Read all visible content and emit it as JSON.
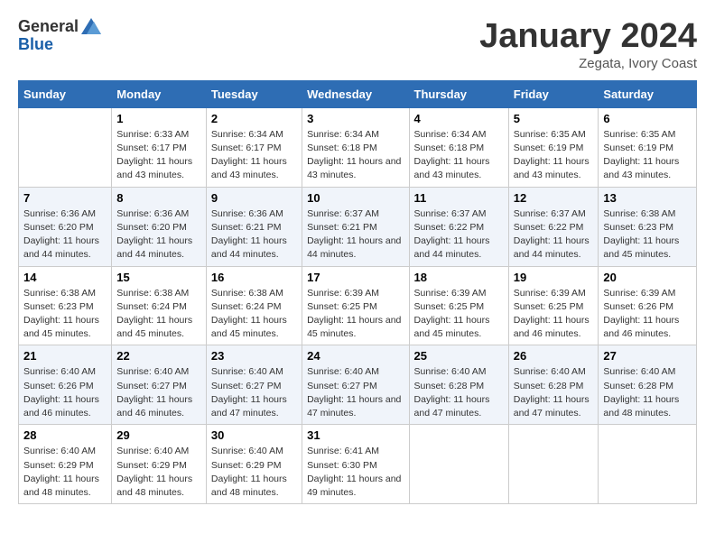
{
  "header": {
    "logo_general": "General",
    "logo_blue": "Blue",
    "month": "January 2024",
    "location": "Zegata, Ivory Coast"
  },
  "weekdays": [
    "Sunday",
    "Monday",
    "Tuesday",
    "Wednesday",
    "Thursday",
    "Friday",
    "Saturday"
  ],
  "weeks": [
    [
      {
        "day": "",
        "sunrise": "",
        "sunset": "",
        "daylight": ""
      },
      {
        "day": "1",
        "sunrise": "Sunrise: 6:33 AM",
        "sunset": "Sunset: 6:17 PM",
        "daylight": "Daylight: 11 hours and 43 minutes."
      },
      {
        "day": "2",
        "sunrise": "Sunrise: 6:34 AM",
        "sunset": "Sunset: 6:17 PM",
        "daylight": "Daylight: 11 hours and 43 minutes."
      },
      {
        "day": "3",
        "sunrise": "Sunrise: 6:34 AM",
        "sunset": "Sunset: 6:18 PM",
        "daylight": "Daylight: 11 hours and 43 minutes."
      },
      {
        "day": "4",
        "sunrise": "Sunrise: 6:34 AM",
        "sunset": "Sunset: 6:18 PM",
        "daylight": "Daylight: 11 hours and 43 minutes."
      },
      {
        "day": "5",
        "sunrise": "Sunrise: 6:35 AM",
        "sunset": "Sunset: 6:19 PM",
        "daylight": "Daylight: 11 hours and 43 minutes."
      },
      {
        "day": "6",
        "sunrise": "Sunrise: 6:35 AM",
        "sunset": "Sunset: 6:19 PM",
        "daylight": "Daylight: 11 hours and 43 minutes."
      }
    ],
    [
      {
        "day": "7",
        "sunrise": "Sunrise: 6:36 AM",
        "sunset": "Sunset: 6:20 PM",
        "daylight": "Daylight: 11 hours and 44 minutes."
      },
      {
        "day": "8",
        "sunrise": "Sunrise: 6:36 AM",
        "sunset": "Sunset: 6:20 PM",
        "daylight": "Daylight: 11 hours and 44 minutes."
      },
      {
        "day": "9",
        "sunrise": "Sunrise: 6:36 AM",
        "sunset": "Sunset: 6:21 PM",
        "daylight": "Daylight: 11 hours and 44 minutes."
      },
      {
        "day": "10",
        "sunrise": "Sunrise: 6:37 AM",
        "sunset": "Sunset: 6:21 PM",
        "daylight": "Daylight: 11 hours and 44 minutes."
      },
      {
        "day": "11",
        "sunrise": "Sunrise: 6:37 AM",
        "sunset": "Sunset: 6:22 PM",
        "daylight": "Daylight: 11 hours and 44 minutes."
      },
      {
        "day": "12",
        "sunrise": "Sunrise: 6:37 AM",
        "sunset": "Sunset: 6:22 PM",
        "daylight": "Daylight: 11 hours and 44 minutes."
      },
      {
        "day": "13",
        "sunrise": "Sunrise: 6:38 AM",
        "sunset": "Sunset: 6:23 PM",
        "daylight": "Daylight: 11 hours and 45 minutes."
      }
    ],
    [
      {
        "day": "14",
        "sunrise": "Sunrise: 6:38 AM",
        "sunset": "Sunset: 6:23 PM",
        "daylight": "Daylight: 11 hours and 45 minutes."
      },
      {
        "day": "15",
        "sunrise": "Sunrise: 6:38 AM",
        "sunset": "Sunset: 6:24 PM",
        "daylight": "Daylight: 11 hours and 45 minutes."
      },
      {
        "day": "16",
        "sunrise": "Sunrise: 6:38 AM",
        "sunset": "Sunset: 6:24 PM",
        "daylight": "Daylight: 11 hours and 45 minutes."
      },
      {
        "day": "17",
        "sunrise": "Sunrise: 6:39 AM",
        "sunset": "Sunset: 6:25 PM",
        "daylight": "Daylight: 11 hours and 45 minutes."
      },
      {
        "day": "18",
        "sunrise": "Sunrise: 6:39 AM",
        "sunset": "Sunset: 6:25 PM",
        "daylight": "Daylight: 11 hours and 45 minutes."
      },
      {
        "day": "19",
        "sunrise": "Sunrise: 6:39 AM",
        "sunset": "Sunset: 6:25 PM",
        "daylight": "Daylight: 11 hours and 46 minutes."
      },
      {
        "day": "20",
        "sunrise": "Sunrise: 6:39 AM",
        "sunset": "Sunset: 6:26 PM",
        "daylight": "Daylight: 11 hours and 46 minutes."
      }
    ],
    [
      {
        "day": "21",
        "sunrise": "Sunrise: 6:40 AM",
        "sunset": "Sunset: 6:26 PM",
        "daylight": "Daylight: 11 hours and 46 minutes."
      },
      {
        "day": "22",
        "sunrise": "Sunrise: 6:40 AM",
        "sunset": "Sunset: 6:27 PM",
        "daylight": "Daylight: 11 hours and 46 minutes."
      },
      {
        "day": "23",
        "sunrise": "Sunrise: 6:40 AM",
        "sunset": "Sunset: 6:27 PM",
        "daylight": "Daylight: 11 hours and 47 minutes."
      },
      {
        "day": "24",
        "sunrise": "Sunrise: 6:40 AM",
        "sunset": "Sunset: 6:27 PM",
        "daylight": "Daylight: 11 hours and 47 minutes."
      },
      {
        "day": "25",
        "sunrise": "Sunrise: 6:40 AM",
        "sunset": "Sunset: 6:28 PM",
        "daylight": "Daylight: 11 hours and 47 minutes."
      },
      {
        "day": "26",
        "sunrise": "Sunrise: 6:40 AM",
        "sunset": "Sunset: 6:28 PM",
        "daylight": "Daylight: 11 hours and 47 minutes."
      },
      {
        "day": "27",
        "sunrise": "Sunrise: 6:40 AM",
        "sunset": "Sunset: 6:28 PM",
        "daylight": "Daylight: 11 hours and 48 minutes."
      }
    ],
    [
      {
        "day": "28",
        "sunrise": "Sunrise: 6:40 AM",
        "sunset": "Sunset: 6:29 PM",
        "daylight": "Daylight: 11 hours and 48 minutes."
      },
      {
        "day": "29",
        "sunrise": "Sunrise: 6:40 AM",
        "sunset": "Sunset: 6:29 PM",
        "daylight": "Daylight: 11 hours and 48 minutes."
      },
      {
        "day": "30",
        "sunrise": "Sunrise: 6:40 AM",
        "sunset": "Sunset: 6:29 PM",
        "daylight": "Daylight: 11 hours and 48 minutes."
      },
      {
        "day": "31",
        "sunrise": "Sunrise: 6:41 AM",
        "sunset": "Sunset: 6:30 PM",
        "daylight": "Daylight: 11 hours and 49 minutes."
      },
      {
        "day": "",
        "sunrise": "",
        "sunset": "",
        "daylight": ""
      },
      {
        "day": "",
        "sunrise": "",
        "sunset": "",
        "daylight": ""
      },
      {
        "day": "",
        "sunrise": "",
        "sunset": "",
        "daylight": ""
      }
    ]
  ]
}
